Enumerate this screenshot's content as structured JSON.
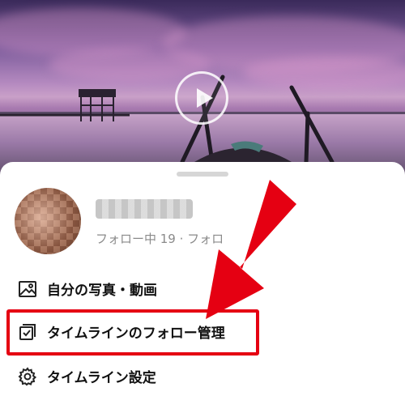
{
  "profile": {
    "name": "",
    "follow_stats": "フォロー中 19 · フォロ"
  },
  "menu": {
    "photos_label": "自分の写真・動画",
    "follow_management_label": "タイムラインのフォロー管理",
    "settings_label": "タイムライン設定"
  },
  "icons": {
    "photos": "image-icon",
    "follow_management": "checkbox-stack-icon",
    "settings": "gear-icon",
    "video": "play-icon"
  },
  "colors": {
    "highlight": "#e50012",
    "text": "#111111",
    "muted": "#8a8a8a"
  }
}
